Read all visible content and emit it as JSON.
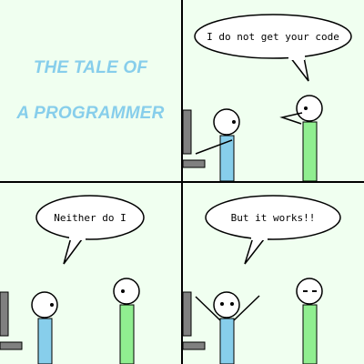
{
  "title": {
    "line1": "THE TALE OF",
    "line2": "A PROGRAMMER",
    "color": "#87ceeb"
  },
  "speech": {
    "panel2": "I do not get your code",
    "panel3": "Neither do I",
    "panel4": "But it works!!"
  },
  "colors": {
    "background": "#f0fff0",
    "programmer_body": "#87ceeb",
    "colleague_body": "#90ee90",
    "chair": "#808080"
  }
}
